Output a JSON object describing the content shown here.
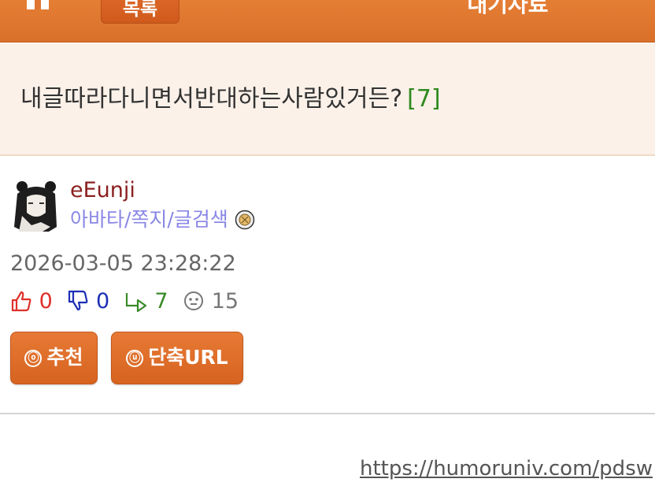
{
  "header": {
    "list_label": "목록",
    "board_title": "대기자료",
    "icons": {
      "home": "home-icon"
    },
    "colors": {
      "bar": "#e07a33",
      "button": "#d9641f"
    }
  },
  "post": {
    "title": "내글따라다니면서반대하는사람있거든?",
    "comment_count": "[7]",
    "author": {
      "nickname": "eEunji",
      "links": "아바타/쪽지/글검색",
      "avatar_icon": "avatar-icon",
      "medal_icon": "medal-icon"
    },
    "date": "2026-03-05 23:28:22",
    "stats": {
      "upvotes": "0",
      "downvotes": "0",
      "replies": "7",
      "views": "15"
    },
    "buttons": {
      "recommend_glyph": "ⓞ",
      "recommend_label": "추천",
      "shorturl_glyph": "ⓤ",
      "shorturl_label": "단축URL"
    },
    "url": "https://humoruniv.com/pdsw"
  }
}
